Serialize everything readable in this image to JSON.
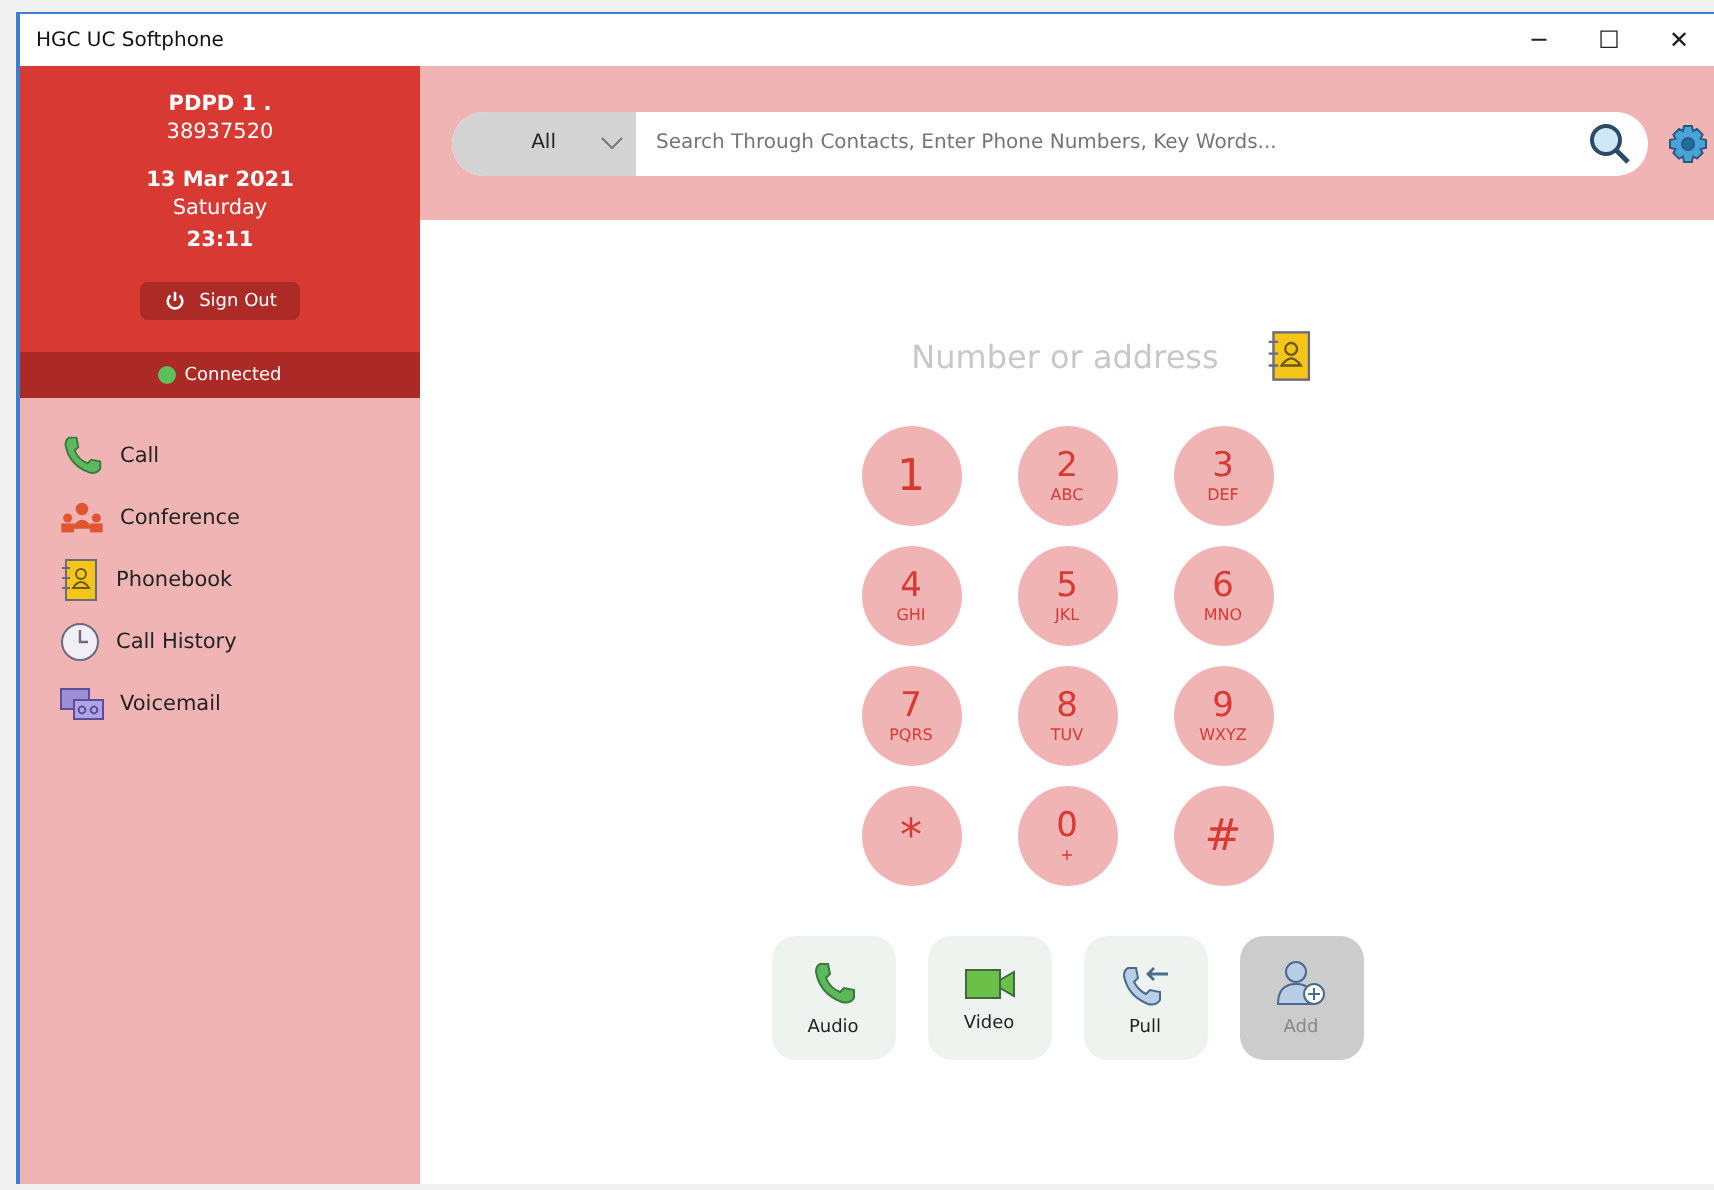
{
  "window": {
    "title": "HGC UC Softphone",
    "controls": [
      "─",
      "☐",
      "✕"
    ]
  },
  "profile": {
    "name": "PDPD 1 .",
    "number": "38937520",
    "date": "13 Mar 2021",
    "weekday": "Saturday",
    "time": "23:11",
    "sign_out": "Sign Out",
    "status": "Connected",
    "connected": true
  },
  "nav": [
    {
      "kind": "call",
      "label": "Call"
    },
    {
      "kind": "conference",
      "label": "Conference"
    },
    {
      "kind": "phonebook",
      "label": "Phonebook"
    },
    {
      "kind": "history",
      "label": "Call History"
    },
    {
      "kind": "voicemail",
      "label": "Voicemail"
    }
  ],
  "search": {
    "filter": "All",
    "placeholder": "Search Through Contacts, Enter Phone Numbers, Key Words..."
  },
  "dial_field": {
    "placeholder": "Number or address"
  },
  "keypad": [
    {
      "digit": "1"
    },
    {
      "digit": "2",
      "letters": "ABC"
    },
    {
      "digit": "3",
      "letters": "DEF"
    },
    {
      "digit": "4",
      "letters": "GHI"
    },
    {
      "digit": "5",
      "letters": "JKL"
    },
    {
      "digit": "6",
      "letters": "MNO"
    },
    {
      "digit": "7",
      "letters": "PQRS"
    },
    {
      "digit": "8",
      "letters": "TUV"
    },
    {
      "digit": "9",
      "letters": "WXYZ"
    },
    {
      "digit": "*"
    },
    {
      "digit": "0",
      "letters": "+"
    },
    {
      "digit": "#"
    }
  ],
  "actions": [
    {
      "kind": "audio",
      "label": "Audio",
      "disabled": false
    },
    {
      "kind": "video",
      "label": "Video",
      "disabled": false
    },
    {
      "kind": "pull",
      "label": "Pull",
      "disabled": false
    },
    {
      "kind": "add",
      "label": "Add",
      "disabled": true
    }
  ]
}
